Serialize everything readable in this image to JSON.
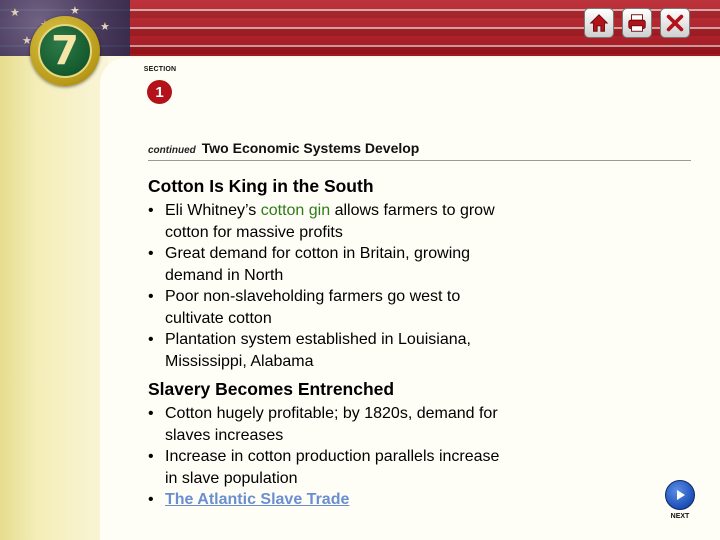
{
  "chapter": {
    "number": "7"
  },
  "toolbar": {
    "home_icon": "home-icon",
    "print_icon": "print-icon",
    "close_icon": "close-icon"
  },
  "section": {
    "label": "SECTION",
    "number": "1"
  },
  "header": {
    "continued": "continued",
    "title": "Two Economic Systems Develop"
  },
  "block1": {
    "heading": "Cotton Is King in the South",
    "bullets": [
      {
        "pre": "Eli Whitney’s ",
        "highlight": "cotton gin",
        "post": " allows farmers to grow",
        "line2": "cotton for massive profits"
      },
      {
        "text": "Great demand for cotton in Britain, growing",
        "line2": "demand in North"
      },
      {
        "text": "Poor non-slaveholding farmers go west to",
        "line2": "cultivate cotton"
      },
      {
        "text": "Plantation system established in Louisiana,",
        "line2": "Mississippi, Alabama"
      }
    ]
  },
  "block2": {
    "heading": "Slavery Becomes Entrenched",
    "bullets": [
      {
        "text": "Cotton hugely profitable; by 1820s, demand for",
        "line2": "slaves increases"
      },
      {
        "text": "Increase in cotton production parallels increase",
        "line2": "in slave population"
      }
    ],
    "link": "The Atlantic Slave Trade"
  },
  "bullet_char": "•",
  "nav": {
    "next_label": "NEXT"
  },
  "colors": {
    "accent_green": "#2f7a1a",
    "link_blue": "#6a8fd0",
    "section_red": "#b3121b"
  }
}
